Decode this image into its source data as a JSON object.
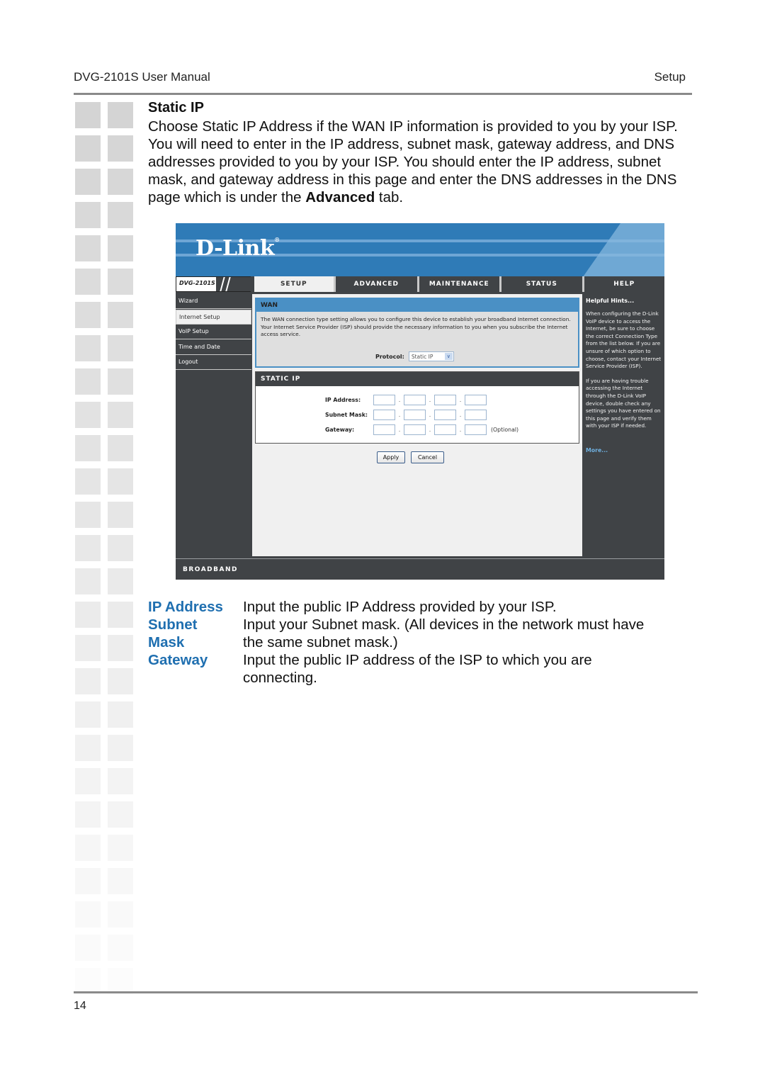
{
  "doc": {
    "header_left": "DVG-2101S User Manual",
    "header_right": "Setup",
    "page_number": "14",
    "section_title": "Static IP",
    "intro_before_bold": "Choose Static IP Address if the WAN IP information is provided to you by your ISP. You will need to enter in the IP address, subnet mask, gateway address, and DNS addresses provided to you by your ISP. You should enter the IP address, subnet mask, and gateway address in this page and enter the DNS addresses in the DNS page which is under the ",
    "intro_bold": "Advanced",
    "intro_after_bold": " tab.",
    "definitions": [
      {
        "term": "IP Address",
        "desc": "Input the public IP Address provided by your ISP."
      },
      {
        "term": "Subnet",
        "desc": "Input your Subnet mask. (All devices in the network must have"
      },
      {
        "term": "Mask",
        "desc": "the same subnet mask.)"
      },
      {
        "term": "Gateway",
        "desc": "Input the public IP address of the ISP to which you are"
      },
      {
        "term": "",
        "desc": "connecting."
      }
    ],
    "colors": {
      "term_blue": "#1f6fb0",
      "rule_gray": "#8a8a8a"
    }
  },
  "router_ui": {
    "logo": "D-Link",
    "logo_mark": "®",
    "model": "DVG-2101S",
    "tabs": [
      {
        "label": "SETUP",
        "active": true
      },
      {
        "label": "ADVANCED",
        "active": false
      },
      {
        "label": "MAINTENANCE",
        "active": false
      },
      {
        "label": "STATUS",
        "active": false
      },
      {
        "label": "HELP",
        "active": false
      }
    ],
    "sidebar": [
      {
        "label": "Wizard",
        "active": false
      },
      {
        "label": "Internet Setup",
        "active": true
      },
      {
        "label": "VoIP Setup",
        "active": false
      },
      {
        "label": "Time and Date",
        "active": false
      },
      {
        "label": "Logout",
        "active": false
      }
    ],
    "wan": {
      "title": "WAN",
      "description": "The WAN connection type setting allows you to configure this device to establish your broadband Internet connection. Your Internet Service Provider (ISP) should provide the necessary information to you when you subscribe the Internet access service.",
      "protocol_label": "Protocol:",
      "protocol_value": "Static IP"
    },
    "static_ip": {
      "title": "STATIC IP",
      "fields": [
        {
          "label": "IP Address:",
          "octets": [
            "",
            "",
            "",
            ""
          ],
          "note": ""
        },
        {
          "label": "Subnet Mask:",
          "octets": [
            "",
            "",
            "",
            ""
          ],
          "note": ""
        },
        {
          "label": "Gateway:",
          "octets": [
            "",
            "",
            "",
            ""
          ],
          "note": "(Optional)"
        }
      ],
      "separator": "."
    },
    "buttons": {
      "apply": "Apply",
      "cancel": "Cancel"
    },
    "hints": {
      "title": "Helpful Hints...",
      "paragraphs": [
        "When configuring the D-Link VoIP device to access the Internet, be sure to choose the correct Connection Type from the list below. If you are unsure of which option to choose, contact your Internet Service Provider (ISP).",
        "If you are having trouble accessing the Internet through the D-Link VoIP device, double check any settings you have entered on this page and verify them with your ISP if needed."
      ],
      "more_link": "More..."
    },
    "footer": "BROADBAND",
    "colors": {
      "banner_blue": "#2f7bb7",
      "panel_blue": "#4a90c5",
      "dark_gray": "#404346",
      "link_blue": "#6fb0e0"
    }
  }
}
